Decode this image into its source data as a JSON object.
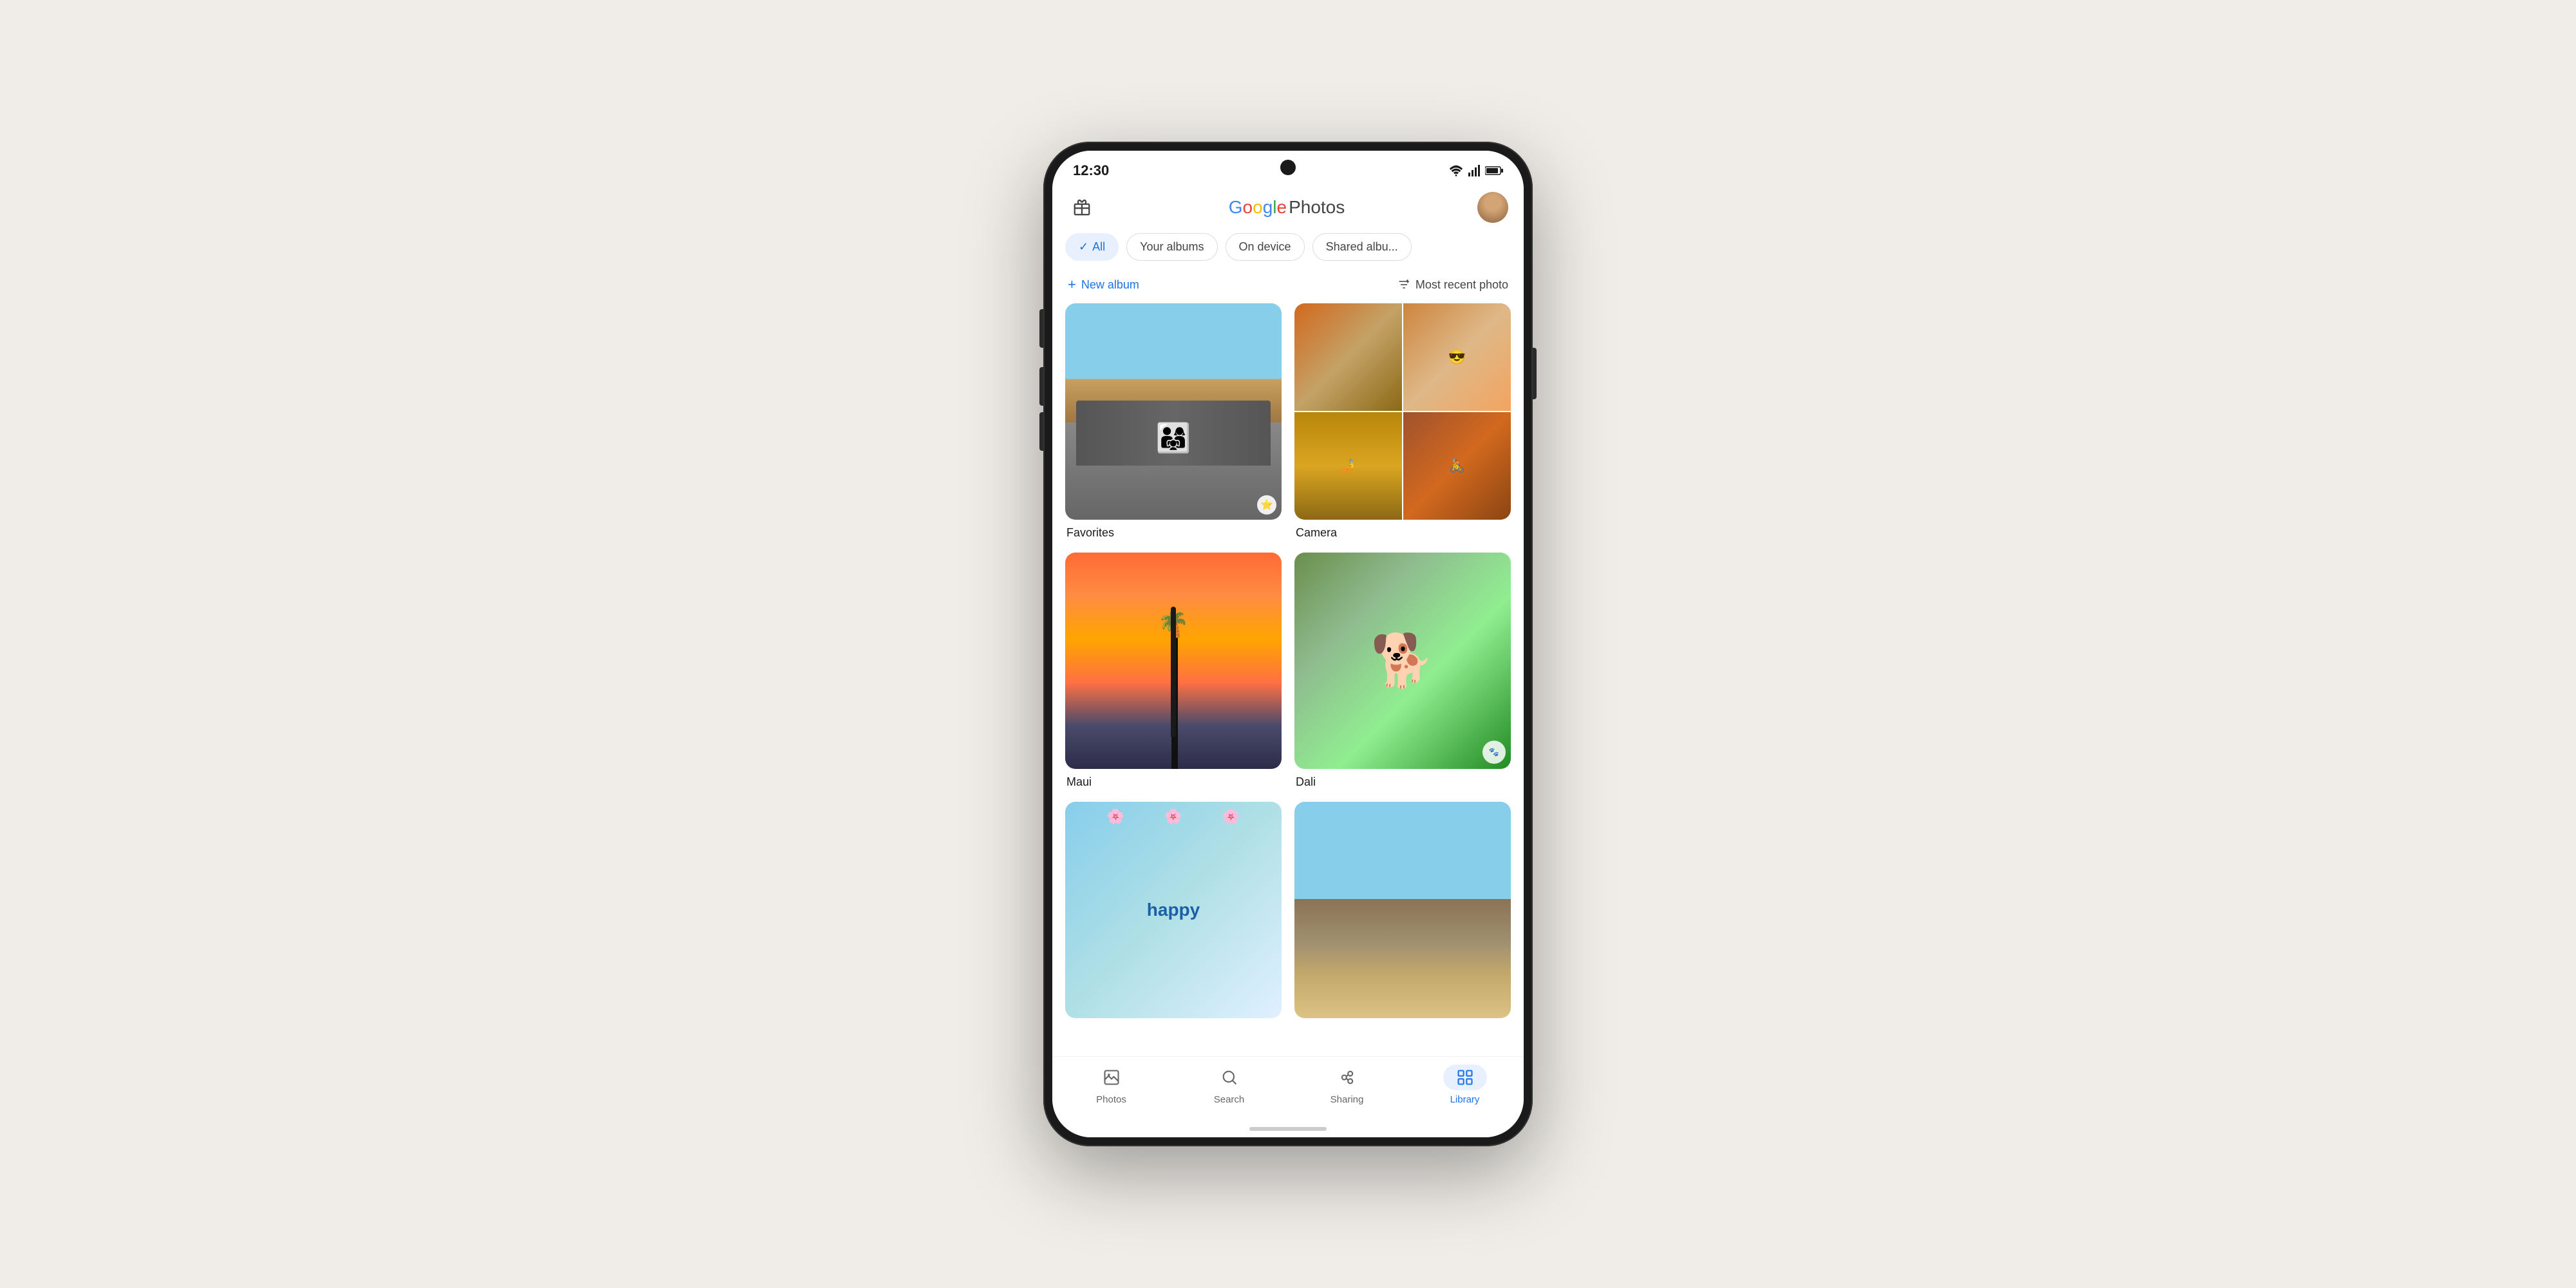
{
  "status": {
    "time": "12:30"
  },
  "header": {
    "logo_google": "Google",
    "logo_photos": "Photos",
    "g": "G",
    "o1": "o",
    "o2": "o",
    "g2": "g",
    "l": "l",
    "e": "e"
  },
  "filter_tabs": {
    "all": "All",
    "your_albums": "Your albums",
    "on_device": "On device",
    "shared_albums": "Shared albu..."
  },
  "toolbar": {
    "new_album": "New album",
    "sort": "Most recent photo"
  },
  "albums": [
    {
      "name": "Favorites",
      "type": "single"
    },
    {
      "name": "Camera",
      "type": "grid"
    },
    {
      "name": "Maui",
      "type": "single-sunset"
    },
    {
      "name": "Dali",
      "type": "single-dog"
    },
    {
      "name": "",
      "type": "single-happy"
    },
    {
      "name": "",
      "type": "single-mountain"
    }
  ],
  "bottom_nav": {
    "items": [
      {
        "label": "Photos",
        "active": false
      },
      {
        "label": "Search",
        "active": false
      },
      {
        "label": "Sharing",
        "active": false
      },
      {
        "label": "Library",
        "active": true
      }
    ]
  }
}
